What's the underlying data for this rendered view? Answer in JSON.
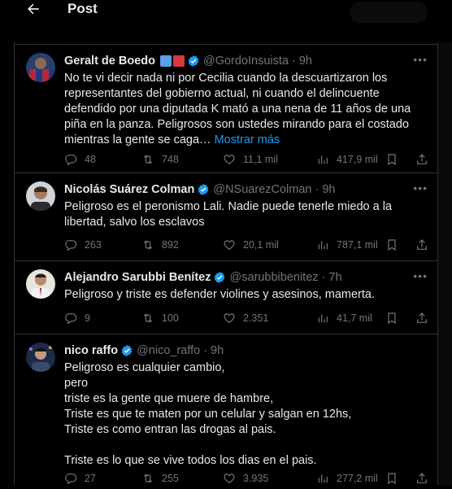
{
  "header": {
    "title": "Post"
  },
  "tweets": [
    {
      "name": "Geralt de Boedo",
      "handle": "@GordoInsuista",
      "sep": "·",
      "time": "9h",
      "text": "No te vi decir nada ni por Cecilia cuando la descuartizaron los representantes del gobierno actual, ni cuando el delincuente defendido por una diputada K mató a una nena de 11 años de una piña en la panza. Peligrosos son ustedes mirando para el costado mientras la gente se caga…",
      "show_more": "Mostrar más",
      "replies": "48",
      "reposts": "748",
      "likes": "11,1 mil",
      "views": "417,9 mil",
      "flag_colors": [
        "#5aa0e6",
        "#d9363e"
      ]
    },
    {
      "name": "Nicolás Suárez Colman",
      "handle": "@NSuarezColman",
      "sep": "·",
      "time": "9h",
      "text": "Peligroso es el peronismo Lali. Nadie puede tenerle miedo a la libertad, salvo los esclavos",
      "replies": "263",
      "reposts": "892",
      "likes": "20,1 mil",
      "views": "787,1 mil"
    },
    {
      "name": "Alejandro Sarubbi Benítez",
      "handle": "@sarubbibenitez",
      "sep": "·",
      "time": "7h",
      "text": "Peligroso y triste es defender violines y asesinos, mamerta.",
      "replies": "9",
      "reposts": "100",
      "likes": "2.351",
      "views": "41,7 mil"
    },
    {
      "name": "nico raffo",
      "handle": "@nico_raffo",
      "sep": "·",
      "time": "9h",
      "text": "Peligroso es cualquier cambio,\npero\n triste es la gente que muere de hambre,\nTriste es que te maten por un celular y salgan en 12hs,\nTriste es como entran las drogas al pais.\n\nTriste es lo que se vive todos los dias en el pais.",
      "replies": "27",
      "reposts": "255",
      "likes": "3.935",
      "views": "277,2 mil"
    }
  ],
  "icons": {
    "back": "arrow-left-icon",
    "verified": "verified-badge-icon",
    "more": "more-icon",
    "reply": "reply-icon",
    "repost": "repost-icon",
    "like": "heart-icon",
    "views": "views-icon",
    "bookmark": "bookmark-icon",
    "share": "share-icon"
  },
  "colors": {
    "accent": "#1d9bf0",
    "muted": "#71767b",
    "border": "#2f3336"
  }
}
